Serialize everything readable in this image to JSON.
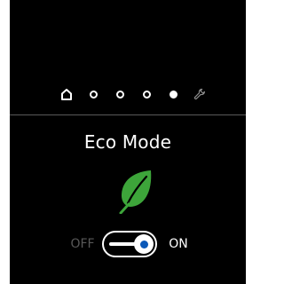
{
  "screen": {
    "background": "#000000",
    "accent": "#3da53a"
  },
  "page_indicator": {
    "items": [
      {
        "icon": "home-icon"
      },
      {
        "icon": "page-dot",
        "state": "inactive"
      },
      {
        "icon": "page-dot",
        "state": "inactive"
      },
      {
        "icon": "page-dot",
        "state": "inactive"
      },
      {
        "icon": "page-dot",
        "state": "active"
      },
      {
        "icon": "wrench-icon"
      }
    ],
    "active_index": 4
  },
  "eco_mode": {
    "title": "Eco Mode",
    "icon": "leaf-icon",
    "toggle": {
      "off_label": "OFF",
      "on_label": "ON",
      "state": "on",
      "knob_color": "#0a58b8"
    }
  }
}
